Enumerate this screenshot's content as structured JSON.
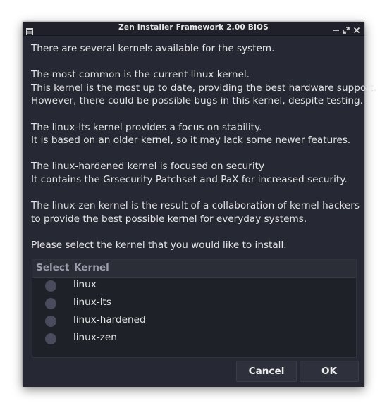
{
  "window": {
    "title": "Zen Installer Framework 2.00 BIOS"
  },
  "message": {
    "paragraphs": [
      [
        "There are several kernels available for the system."
      ],
      [
        "The most common is the current linux kernel.",
        "This kernel is the most up to date, providing the best hardware support.",
        "However, there could be possible bugs in this kernel, despite testing."
      ],
      [
        "The linux-lts kernel provides a focus on stability.",
        "It is based on an older kernel, so it may lack some newer features."
      ],
      [
        "The linux-hardened kernel is focused on security",
        "It contains the Grsecurity Patchset and PaX for increased security."
      ],
      [
        "The linux-zen kernel is the result of a collaboration of kernel hackers",
        "to provide the best possible kernel for everyday systems."
      ],
      [
        "Please select the kernel that you would like to install."
      ]
    ]
  },
  "table": {
    "columns": [
      "Select",
      "Kernel"
    ],
    "rows": [
      {
        "kernel": "linux",
        "selected": false
      },
      {
        "kernel": "linux-lts",
        "selected": false
      },
      {
        "kernel": "linux-hardened",
        "selected": false
      },
      {
        "kernel": "linux-zen",
        "selected": false
      }
    ]
  },
  "buttons": {
    "cancel": "Cancel",
    "ok": "OK"
  },
  "colors": {
    "window_bg": "#262833",
    "titlebar_bg": "#1f2029",
    "text": "#e4e4e4",
    "radio": "#4a4c5d"
  },
  "icons": {
    "window_menu": "window-menu-icon",
    "minimize": "minimize-icon",
    "maximize": "maximize-icon",
    "close": "close-icon"
  }
}
